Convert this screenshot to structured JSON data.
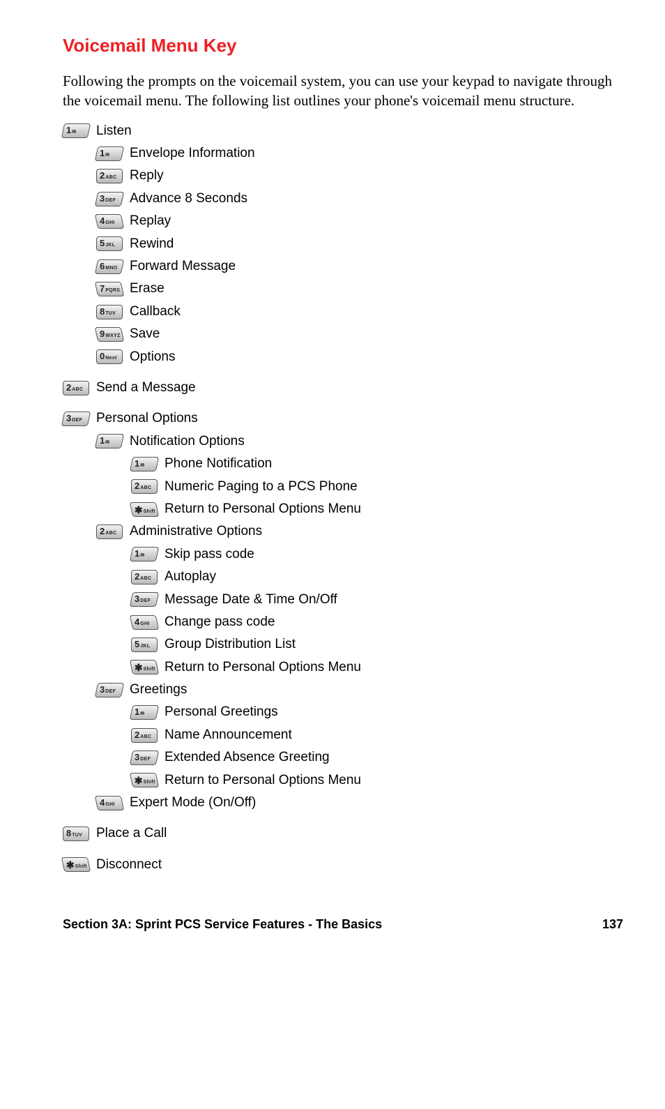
{
  "title": "Voicemail Menu Key",
  "intro": "Following the prompts on the voicemail system, you can use your keypad to navigate through the voicemail menu. The following list outlines your phone's voicemail menu structure.",
  "footer": {
    "section": "Section 3A: Sprint PCS Service Features - The Basics",
    "page": "137"
  },
  "keys": {
    "1": {
      "big": "1",
      "sub": "✉"
    },
    "2": {
      "big": "2",
      "sub": "ABC"
    },
    "3": {
      "big": "3",
      "sub": "DEF"
    },
    "4": {
      "big": "4",
      "sub": "GHI"
    },
    "5": {
      "big": "5",
      "sub": "JKL"
    },
    "6": {
      "big": "6",
      "sub": "MNO"
    },
    "7": {
      "big": "7",
      "sub": "PQRS"
    },
    "8": {
      "big": "8",
      "sub": "TUV"
    },
    "9": {
      "big": "9",
      "sub": "WXYZ"
    },
    "0": {
      "big": "0",
      "sub": "Next"
    },
    "*": {
      "big": "✱",
      "sub": "Shift"
    }
  },
  "menu": [
    {
      "indent": 0,
      "key": "1",
      "label": "Listen"
    },
    {
      "indent": 1,
      "key": "1",
      "label": "Envelope Information"
    },
    {
      "indent": 1,
      "key": "2",
      "label": "Reply"
    },
    {
      "indent": 1,
      "key": "3",
      "label": "Advance 8 Seconds"
    },
    {
      "indent": 1,
      "key": "4",
      "label": "Replay"
    },
    {
      "indent": 1,
      "key": "5",
      "label": "Rewind"
    },
    {
      "indent": 1,
      "key": "6",
      "label": "Forward Message"
    },
    {
      "indent": 1,
      "key": "7",
      "label": "Erase"
    },
    {
      "indent": 1,
      "key": "8",
      "label": "Callback"
    },
    {
      "indent": 1,
      "key": "9",
      "label": "Save"
    },
    {
      "indent": 1,
      "key": "0",
      "label": "Options"
    },
    {
      "spacer": true
    },
    {
      "indent": 0,
      "key": "2",
      "label": "Send a Message"
    },
    {
      "spacer": true
    },
    {
      "indent": 0,
      "key": "3",
      "label": "Personal Options"
    },
    {
      "indent": 1,
      "key": "1",
      "label": "Notification Options"
    },
    {
      "indent": 2,
      "key": "1",
      "label": "Phone Notification"
    },
    {
      "indent": 2,
      "key": "2",
      "label": "Numeric Paging to a PCS Phone"
    },
    {
      "indent": 2,
      "key": "*",
      "label": "Return to Personal Options Menu"
    },
    {
      "indent": 1,
      "key": "2",
      "label": "Administrative Options"
    },
    {
      "indent": 2,
      "key": "1",
      "label": "Skip pass code"
    },
    {
      "indent": 2,
      "key": "2",
      "label": "Autoplay"
    },
    {
      "indent": 2,
      "key": "3",
      "label": "Message Date & Time On/Off"
    },
    {
      "indent": 2,
      "key": "4",
      "label": "Change pass code"
    },
    {
      "indent": 2,
      "key": "5",
      "label": "Group Distribution List"
    },
    {
      "indent": 2,
      "key": "*",
      "label": "Return to Personal Options Menu"
    },
    {
      "indent": 1,
      "key": "3",
      "label": "Greetings"
    },
    {
      "indent": 2,
      "key": "1",
      "label": "Personal Greetings"
    },
    {
      "indent": 2,
      "key": "2",
      "label": "Name Announcement"
    },
    {
      "indent": 2,
      "key": "3",
      "label": "Extended Absence Greeting"
    },
    {
      "indent": 2,
      "key": "*",
      "label": "Return to Personal Options Menu"
    },
    {
      "indent": 1,
      "key": "4",
      "label": "Expert Mode (On/Off)"
    },
    {
      "spacer": true
    },
    {
      "indent": 0,
      "key": "8",
      "label": "Place a Call"
    },
    {
      "spacer": true
    },
    {
      "indent": 0,
      "key": "*",
      "label": "Disconnect"
    }
  ]
}
